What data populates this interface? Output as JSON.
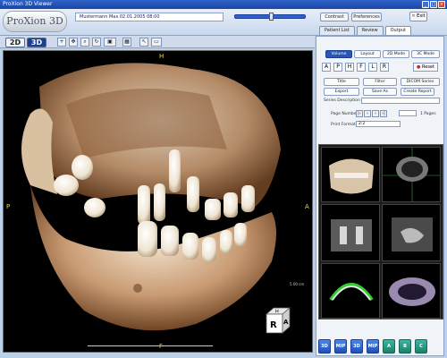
{
  "window": {
    "title": "ProXion 3D Viewer",
    "controls": [
      "_",
      "□",
      "×"
    ]
  },
  "header": {
    "logo": "ProXion 3D",
    "patient_info": "Mustermann Max 02.01.2005 08:00",
    "contrast_label": "Contrast",
    "preferences_label": "Preferences",
    "exit_label": "Exit"
  },
  "tabs": [
    {
      "label": "Patient List",
      "active": false
    },
    {
      "label": "Review",
      "active": false
    },
    {
      "label": "Output",
      "active": true
    }
  ],
  "toolbar": {
    "mode_2d": "2D",
    "mode_3d": "3D",
    "active_mode": "3D",
    "tools": [
      "crosshair-icon",
      "pan-icon",
      "zoom-icon",
      "rotate-icon",
      "camera-icon",
      "layout-icon",
      "pointer-icon",
      "measure-icon"
    ]
  },
  "viewport": {
    "orientation": {
      "top": "H",
      "bottom": "F",
      "left": "P",
      "right": "A"
    },
    "scale_label": "5.00 cm",
    "cube_letters": [
      "R",
      "A",
      "H"
    ]
  },
  "right_panel": {
    "view_tabs": [
      "Volume",
      "Layout",
      "2D Mode",
      "3C Mode"
    ],
    "view_letters": [
      "A",
      "P",
      "H",
      "F",
      "L",
      "R"
    ],
    "reset_label": "Reset",
    "toggles": [
      "Title",
      "Filter",
      "DICOM Series"
    ],
    "actions": [
      "Export",
      "Save As",
      "Create Report"
    ],
    "series_description_label": "Series Description",
    "page_number_label": "Page Number",
    "page_total": "1 Pages",
    "print_format_label": "Print Format",
    "print_format_value": "2:2"
  },
  "bottom_buttons": [
    "3D",
    "MIP",
    "3D",
    "MIP",
    "A",
    "B",
    "C"
  ]
}
